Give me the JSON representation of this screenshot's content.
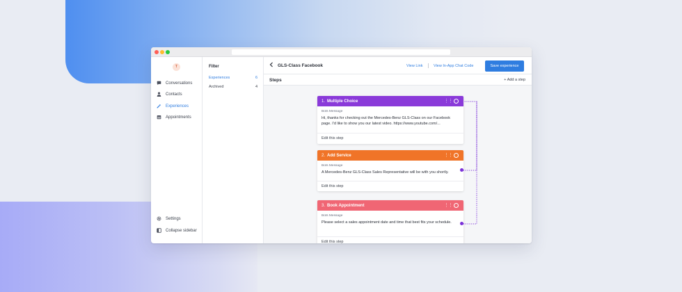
{
  "sidebar": {
    "logo": "T",
    "items": [
      {
        "label": "Conversations",
        "icon": "chat-bubble-icon"
      },
      {
        "label": "Contacts",
        "icon": "person-icon"
      },
      {
        "label": "Experiences",
        "icon": "magic-wand-icon"
      },
      {
        "label": "Appointments",
        "icon": "calendar-icon"
      }
    ],
    "bottom": [
      {
        "label": "Settings",
        "icon": "gear-icon"
      },
      {
        "label": "Collapse sidebar",
        "icon": "collapse-icon"
      }
    ]
  },
  "filter": {
    "title": "Filter",
    "rows": [
      {
        "label": "Experiences",
        "count": "6"
      },
      {
        "label": "Archived",
        "count": "4"
      }
    ]
  },
  "header": {
    "back_icon": "chevron-left-icon",
    "title": "GLS-Class Facebook",
    "view_link": "View Link",
    "view_code": "View In-App Chat Code",
    "save": "Save experience"
  },
  "steps": {
    "label": "Steps",
    "add": "+ Add a step",
    "cards": [
      {
        "num": "1.",
        "name": "Multiple Choice",
        "color": "#8a3ad9",
        "bots_label": "Bots Message",
        "message": "Hi, thanks for checking out the Mercedes-Benz GLS-Class on our Facebook page. I'd like to show you our latest video. https://www.youtube.com/...",
        "edit": "Edit this step"
      },
      {
        "num": "2.",
        "name": "Add Service",
        "color": "#f07428",
        "bots_label": "Bots Message",
        "message": "A Mercedes-Benz GLS-Class Sales Representative will be with you shortly.",
        "edit": "Edit this step"
      },
      {
        "num": "3.",
        "name": "Book Appointment",
        "color": "#f06674",
        "bots_label": "Bots Message",
        "message": "Please select a sales appointment date and time that best fits your schedule.",
        "edit": "Edit this step"
      }
    ]
  },
  "colors": {
    "accent": "#2f7de0",
    "connector": "#7a2fd8"
  }
}
